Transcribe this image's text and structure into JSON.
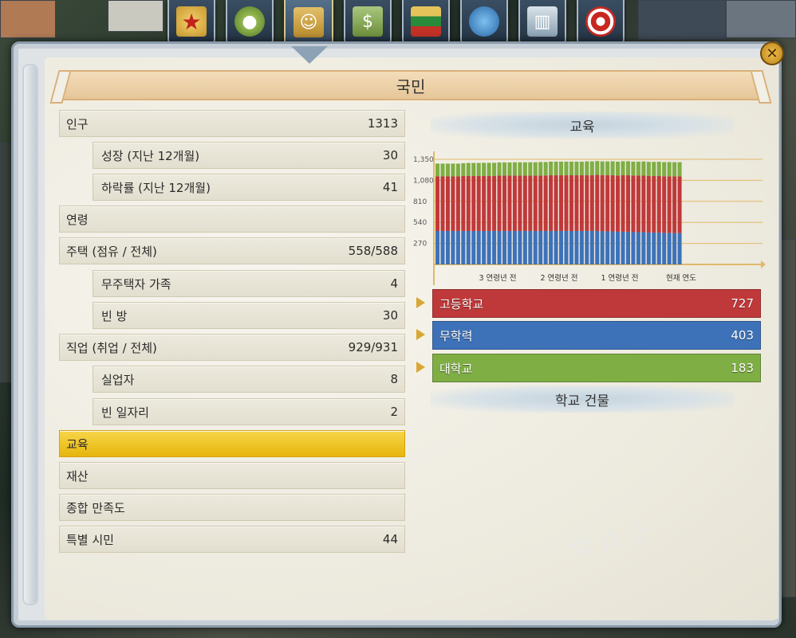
{
  "tabs": [
    {
      "icon": "star-icon"
    },
    {
      "icon": "apple-icon"
    },
    {
      "icon": "people-portrait-icon",
      "active": true
    },
    {
      "icon": "money-icon"
    },
    {
      "icon": "flag-icon"
    },
    {
      "icon": "globe-icon"
    },
    {
      "icon": "building-icon"
    },
    {
      "icon": "target-icon"
    }
  ],
  "panel": {
    "title": "국민",
    "close_label": "✕"
  },
  "stats": {
    "population": {
      "label": "인구",
      "value": "1313"
    },
    "growth": {
      "label": "성장 (지난 12개월)",
      "value": "30"
    },
    "decline": {
      "label": "하락률 (지난 12개월)",
      "value": "41"
    },
    "age": {
      "label": "연령",
      "value": ""
    },
    "housing": {
      "label": "주택 (점유 / 전체)",
      "value": "558/588"
    },
    "homeless": {
      "label": "무주택자 가족",
      "value": "4"
    },
    "empty_rooms": {
      "label": "빈 방",
      "value": "30"
    },
    "jobs": {
      "label": "직업 (취업 / 전체)",
      "value": "929/931"
    },
    "unemployed": {
      "label": "실업자",
      "value": "8"
    },
    "vacancies": {
      "label": "빈 일자리",
      "value": "2"
    },
    "education": {
      "label": "교육",
      "value": ""
    },
    "wealth": {
      "label": "재산",
      "value": ""
    },
    "satisfaction": {
      "label": "종합 만족도",
      "value": ""
    },
    "special": {
      "label": "특별 시민",
      "value": "44"
    }
  },
  "education": {
    "heading": "교육",
    "school_heading": "학교 건물",
    "legend": [
      {
        "label": "고등학교",
        "value": "727",
        "color": "#c0393a"
      },
      {
        "label": "무학력",
        "value": "403",
        "color": "#3e72b8"
      },
      {
        "label": "대학교",
        "value": "183",
        "color": "#7fae45"
      }
    ]
  },
  "chart_data": {
    "type": "bar",
    "stacked": true,
    "yticks": [
      "270",
      "540",
      "810",
      "1,080",
      "1,350"
    ],
    "ylim": [
      0,
      1350
    ],
    "xticks": [
      "3 연령년 전",
      "2 연령년 전",
      "1 연령년 전",
      "현재 연도"
    ],
    "bar_count": 48,
    "series": [
      {
        "name": "무학력",
        "color": "#3e72b8",
        "values": [
          430,
          430,
          430,
          430,
          430,
          430,
          430,
          430,
          430,
          430,
          430,
          430,
          430,
          430,
          430,
          430,
          430,
          430,
          430,
          430,
          430,
          430,
          430,
          430,
          430,
          430,
          430,
          430,
          430,
          430,
          430,
          430,
          425,
          425,
          425,
          420,
          420,
          420,
          415,
          415,
          415,
          410,
          410,
          410,
          405,
          405,
          403,
          403
        ]
      },
      {
        "name": "고등학교",
        "color": "#c0393a",
        "values": [
          700,
          700,
          700,
          700,
          700,
          705,
          705,
          705,
          705,
          705,
          705,
          705,
          710,
          710,
          710,
          710,
          710,
          710,
          710,
          710,
          710,
          710,
          715,
          715,
          715,
          715,
          715,
          715,
          715,
          715,
          715,
          720,
          720,
          720,
          720,
          720,
          725,
          725,
          725,
          725,
          725,
          725,
          725,
          727,
          727,
          727,
          727,
          727
        ]
      },
      {
        "name": "대학교",
        "color": "#7fae45",
        "values": [
          165,
          165,
          165,
          165,
          165,
          165,
          168,
          168,
          168,
          170,
          170,
          170,
          170,
          170,
          170,
          172,
          172,
          172,
          172,
          172,
          175,
          175,
          175,
          175,
          175,
          175,
          175,
          175,
          175,
          178,
          178,
          178,
          178,
          178,
          180,
          180,
          180,
          180,
          180,
          180,
          182,
          182,
          182,
          182,
          182,
          183,
          183,
          183
        ]
      }
    ]
  }
}
